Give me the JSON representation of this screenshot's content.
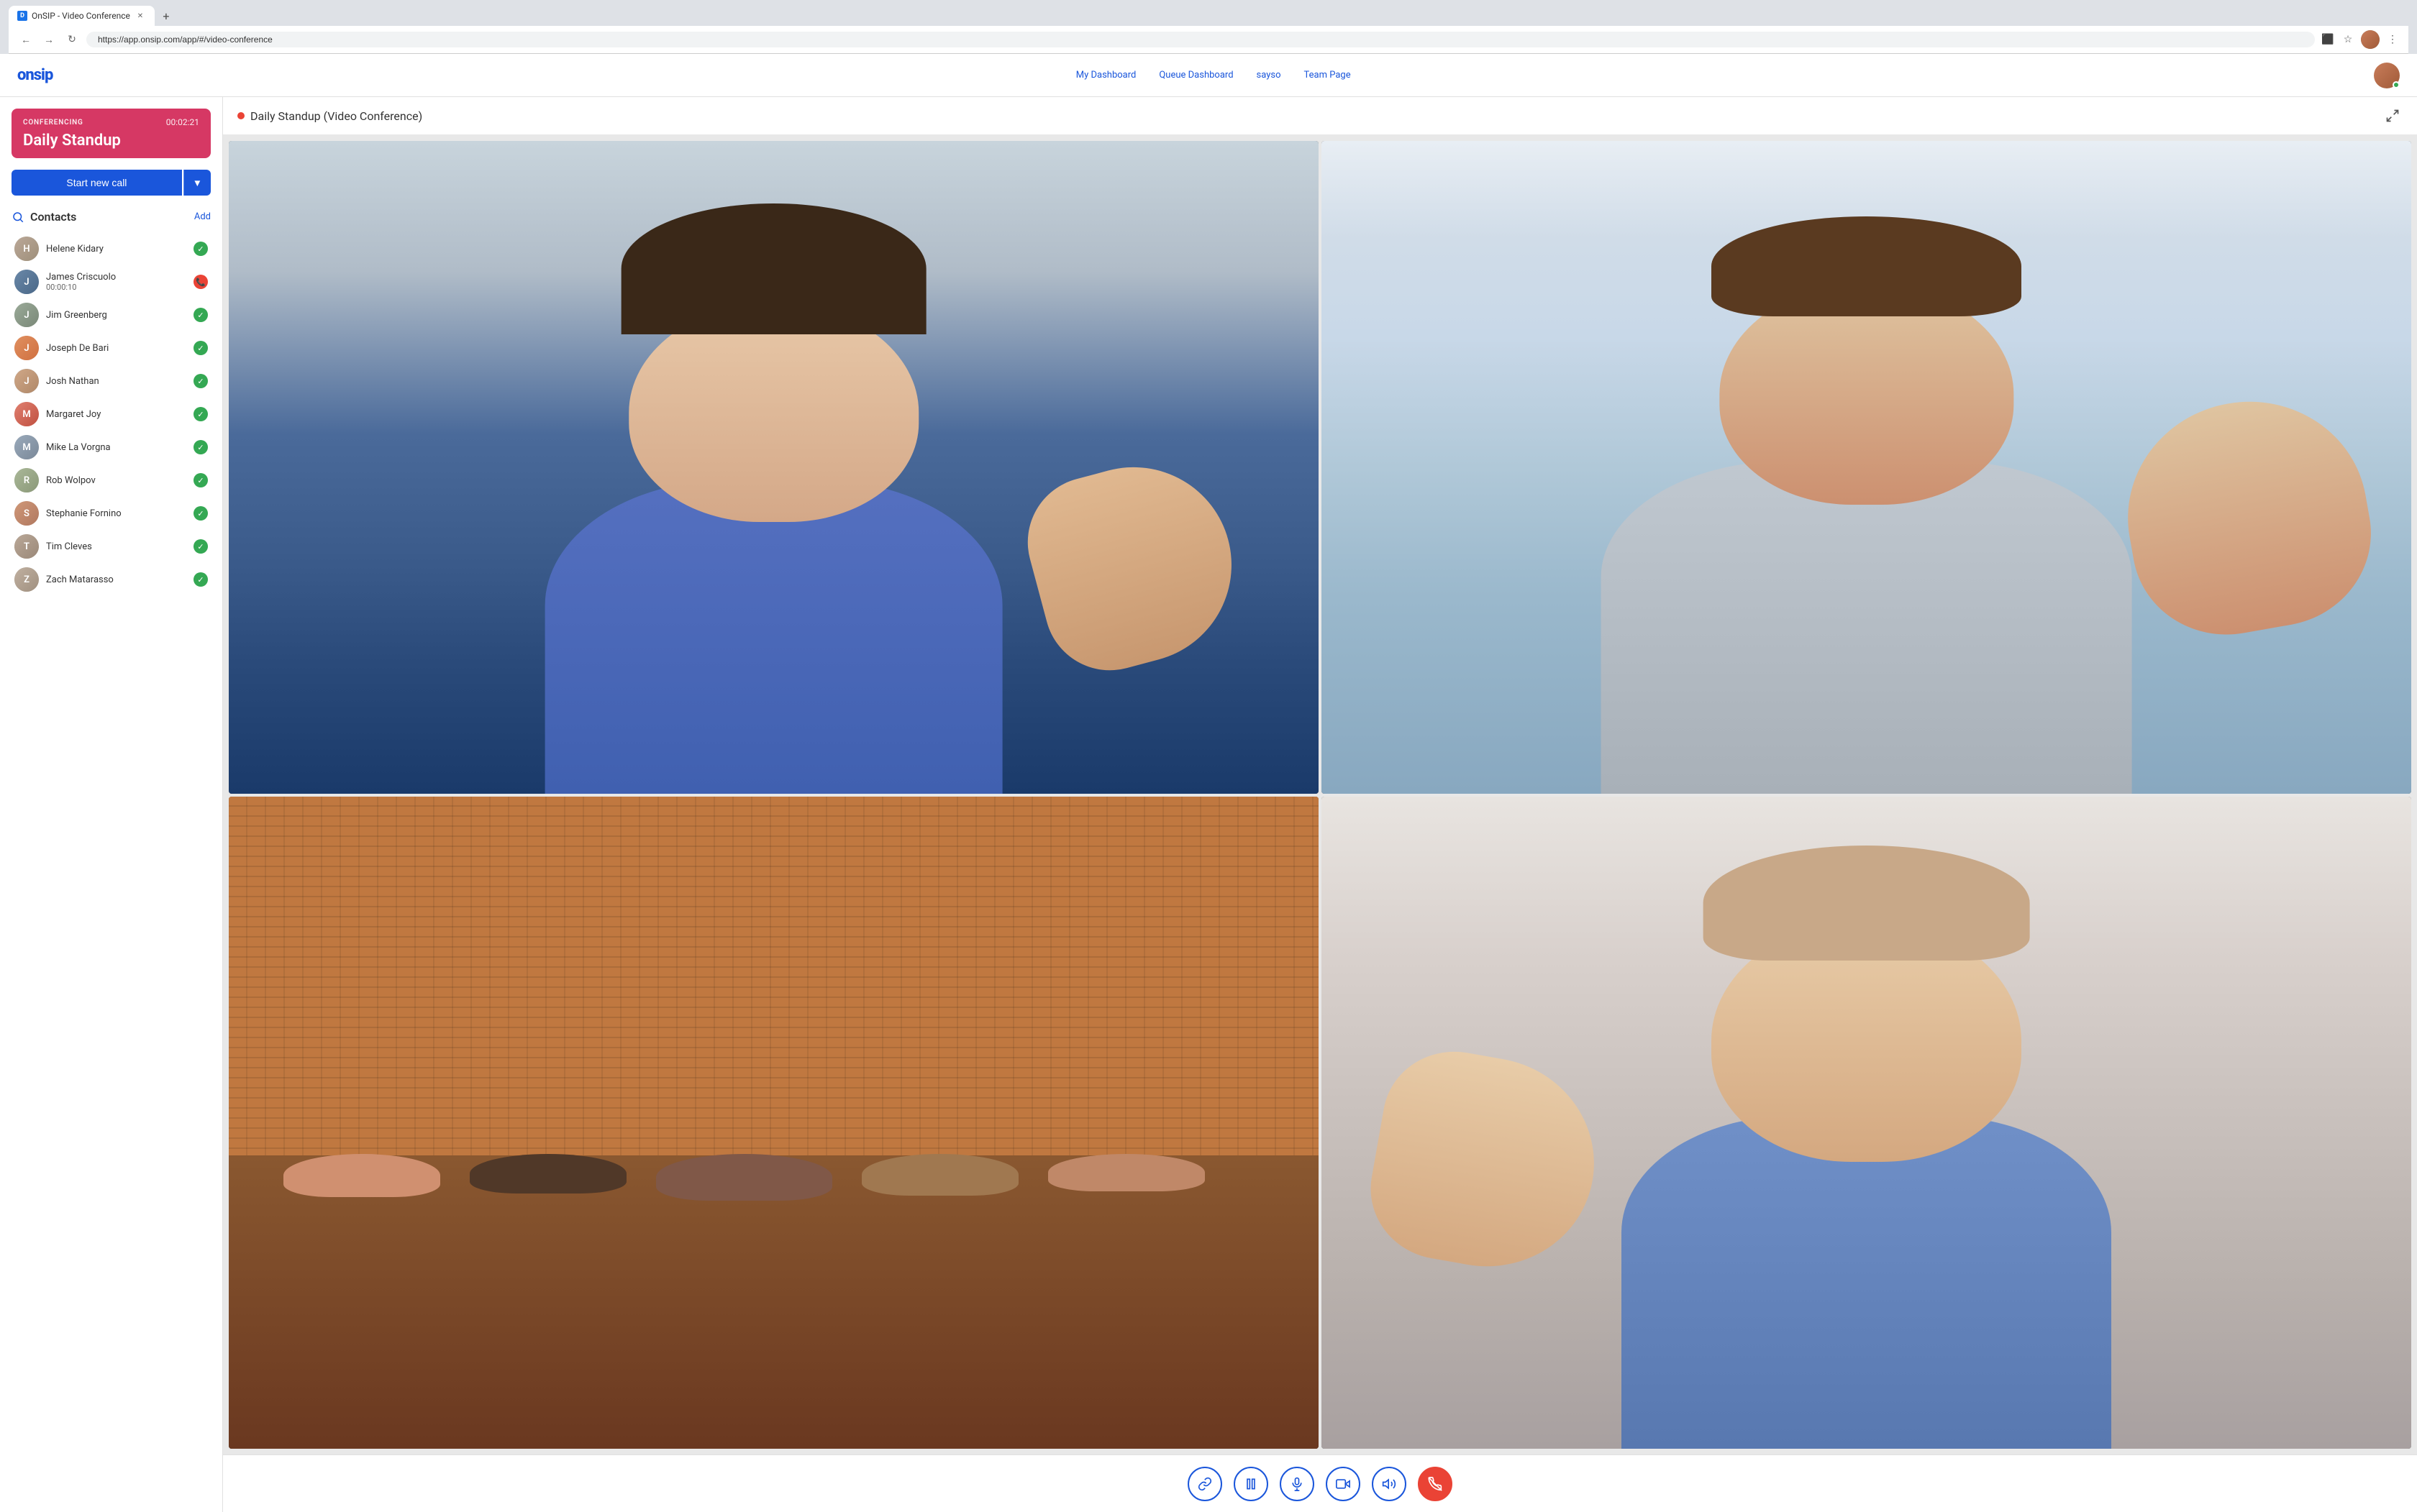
{
  "browser": {
    "tab_label": "OnSIP - Video Conference",
    "url": "https://app.onsip.com/app/#/video-conference",
    "favicon_letter": "D"
  },
  "nav": {
    "logo": "onsip",
    "links": [
      "My Dashboard",
      "Queue Dashboard",
      "sayso",
      "Team Page"
    ]
  },
  "sidebar": {
    "conferencing_label": "CONFERENCING",
    "conferencing_timer": "00:02:21",
    "conferencing_title": "Daily Standup",
    "start_call_label": "Start new call",
    "contacts_title": "Contacts",
    "add_label": "Add",
    "contacts": [
      {
        "name": "Helene Kidary",
        "status": "online",
        "badge": "check"
      },
      {
        "name": "James Criscuolo",
        "status": "00:00:10",
        "badge": "phone"
      },
      {
        "name": "Jim Greenberg",
        "status": "online",
        "badge": "check"
      },
      {
        "name": "Joseph De Bari",
        "status": "online",
        "badge": "check"
      },
      {
        "name": "Josh Nathan",
        "status": "online",
        "badge": "check"
      },
      {
        "name": "Margaret Joy",
        "status": "online",
        "badge": "check"
      },
      {
        "name": "Mike La Vorgna",
        "status": "online",
        "badge": "check"
      },
      {
        "name": "Rob Wolpov",
        "status": "online",
        "badge": "check"
      },
      {
        "name": "Stephanie Fornino",
        "status": "online",
        "badge": "check"
      },
      {
        "name": "Tim Cleves",
        "status": "online",
        "badge": "check"
      },
      {
        "name": "Zach Matarasso",
        "status": "online",
        "badge": "check"
      }
    ],
    "avatar_colors": [
      "#9e8f7a",
      "#5a7a9e",
      "#7a8a6a",
      "#e89060",
      "#a07058",
      "#e87060",
      "#7a8a9a",
      "#8a9a7a",
      "#c07860",
      "#9a8a7a",
      "#a09080"
    ]
  },
  "video_conference": {
    "title": "Daily Standup (Video Conference)",
    "recording_active": true
  },
  "controls": {
    "link_icon": "🔗",
    "pause_icon": "⏸",
    "mic_icon": "🎤",
    "camera_icon": "📹",
    "volume_icon": "🔊",
    "end_icon": "📞"
  }
}
